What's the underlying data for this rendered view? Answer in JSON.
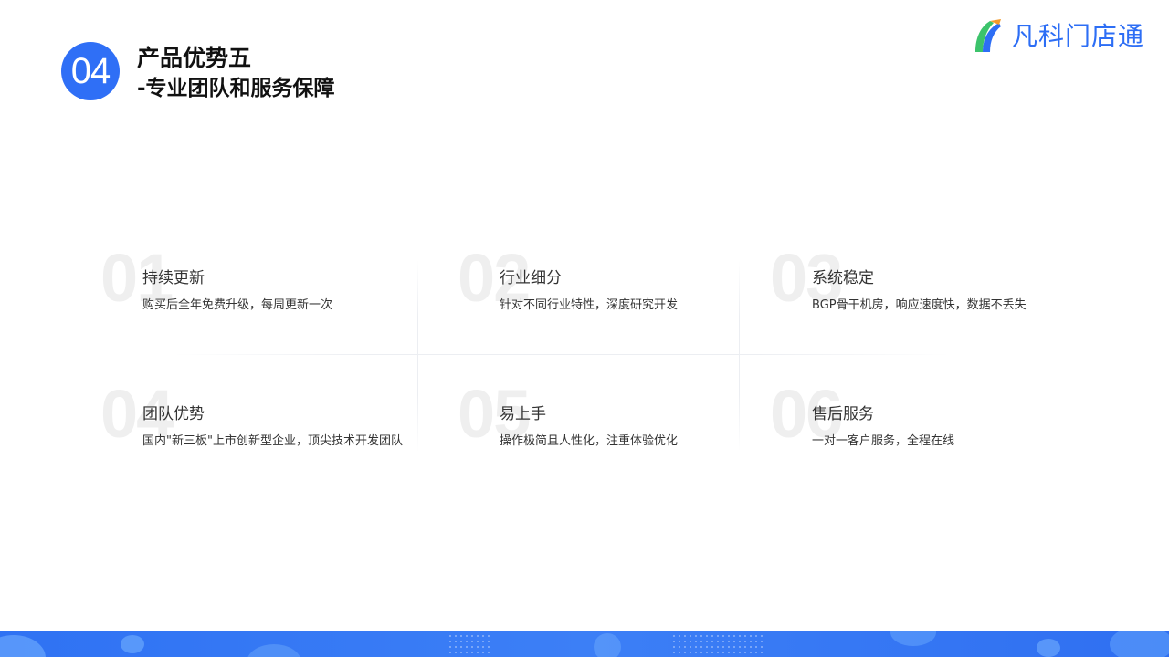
{
  "header": {
    "section_number": "04",
    "title": "产品优势五",
    "subtitle": "-专业团队和服务保障"
  },
  "logo": {
    "text": "凡科门店通",
    "colors": {
      "green": "#3cc36b",
      "blue": "#2d6ef5",
      "orange": "#f39a2b"
    }
  },
  "features": [
    {
      "num": "01",
      "title": "持续更新",
      "desc": "购买后全年免费升级，每周更新一次"
    },
    {
      "num": "02",
      "title": "行业细分",
      "desc": "针对不同行业特性，深度研究开发"
    },
    {
      "num": "03",
      "title": "系统稳定",
      "desc": "BGP骨干机房，响应速度快，数据不丢失"
    },
    {
      "num": "04",
      "title": "团队优势",
      "desc": "国内\"新三板\"上市创新型企业，顶尖技术开发团队"
    },
    {
      "num": "05",
      "title": "易上手",
      "desc": "操作极简且人性化，注重体验优化"
    },
    {
      "num": "06",
      "title": "售后服务",
      "desc": "一对一客户服务，全程在线"
    }
  ],
  "colors": {
    "accent": "#2f6ff6",
    "footer": "#3479f4"
  }
}
